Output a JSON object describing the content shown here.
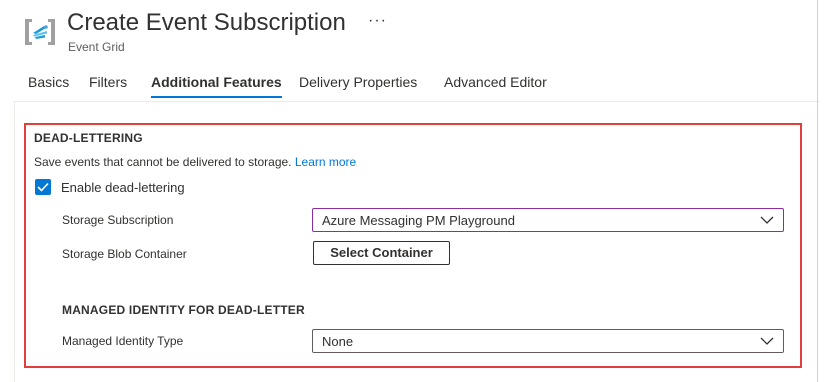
{
  "header": {
    "title": "Create Event Subscription",
    "subtitle": "Event Grid",
    "more_label": "···",
    "icon": "event-grid-icon"
  },
  "tabs": [
    {
      "label": "Basics",
      "active": false
    },
    {
      "label": "Filters",
      "active": false
    },
    {
      "label": "Additional Features",
      "active": true
    },
    {
      "label": "Delivery Properties",
      "active": false
    },
    {
      "label": "Advanced Editor",
      "active": false
    }
  ],
  "dead_lettering": {
    "heading": "DEAD-LETTERING",
    "description": "Save events that cannot be delivered to storage.",
    "learn_more": "Learn more",
    "enable_label": "Enable dead-lettering",
    "enabled": true,
    "storage_subscription_label": "Storage Subscription",
    "storage_subscription_value": "Azure Messaging PM Playground",
    "storage_container_label": "Storage Blob Container",
    "select_container_label": "Select Container"
  },
  "managed_identity": {
    "heading": "MANAGED IDENTITY FOR DEAD-LETTER",
    "type_label": "Managed Identity Type",
    "type_value": "None"
  },
  "colors": {
    "accent": "#0078d4",
    "highlight": "#e0403a",
    "focus": "#8a2da5"
  }
}
